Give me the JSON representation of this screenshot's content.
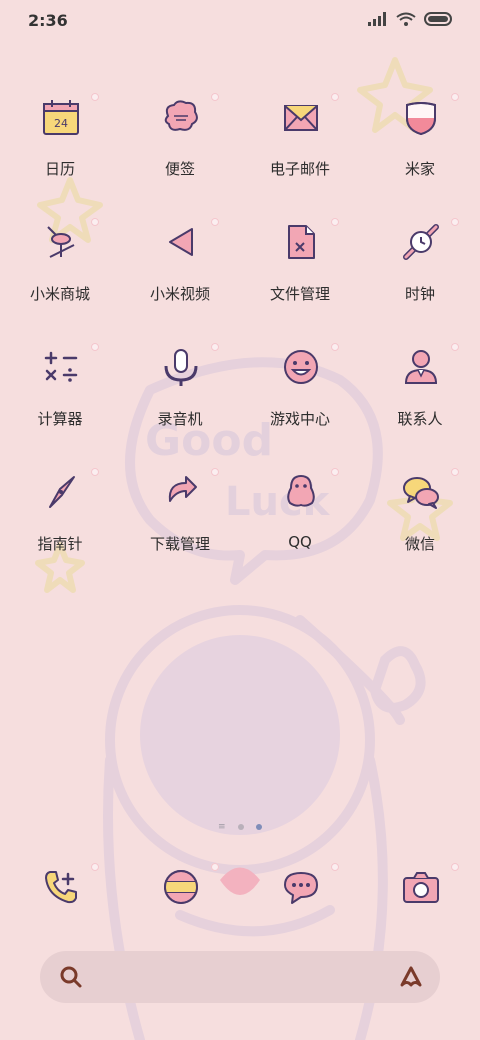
{
  "status_bar": {
    "time": "2:36"
  },
  "apps": [
    [
      {
        "label": "日历",
        "icon": "calendar-icon",
        "badge": "24"
      },
      {
        "label": "便签",
        "icon": "notes-icon"
      },
      {
        "label": "电子邮件",
        "icon": "mail-icon"
      },
      {
        "label": "米家",
        "icon": "mijia-icon"
      }
    ],
    [
      {
        "label": "小米商城",
        "icon": "mi-store-icon"
      },
      {
        "label": "小米视频",
        "icon": "video-icon"
      },
      {
        "label": "文件管理",
        "icon": "file-manager-icon"
      },
      {
        "label": "时钟",
        "icon": "clock-icon"
      }
    ],
    [
      {
        "label": "计算器",
        "icon": "calculator-icon"
      },
      {
        "label": "录音机",
        "icon": "recorder-icon"
      },
      {
        "label": "游戏中心",
        "icon": "game-center-icon"
      },
      {
        "label": "联系人",
        "icon": "contacts-icon"
      }
    ],
    [
      {
        "label": "指南针",
        "icon": "compass-icon"
      },
      {
        "label": "下载管理",
        "icon": "downloads-icon"
      },
      {
        "label": "QQ",
        "icon": "qq-icon"
      },
      {
        "label": "微信",
        "icon": "wechat-icon"
      }
    ]
  ],
  "dock": [
    {
      "icon": "phone-icon"
    },
    {
      "icon": "browser-icon"
    },
    {
      "icon": "messages-icon"
    },
    {
      "icon": "camera-icon"
    }
  ],
  "wallpaper_text": "Good Luck",
  "colors": {
    "background": "#f6dede",
    "outline": "#4a3a6a",
    "pink": "#f2a6b4",
    "yellow": "#f7d77a"
  }
}
